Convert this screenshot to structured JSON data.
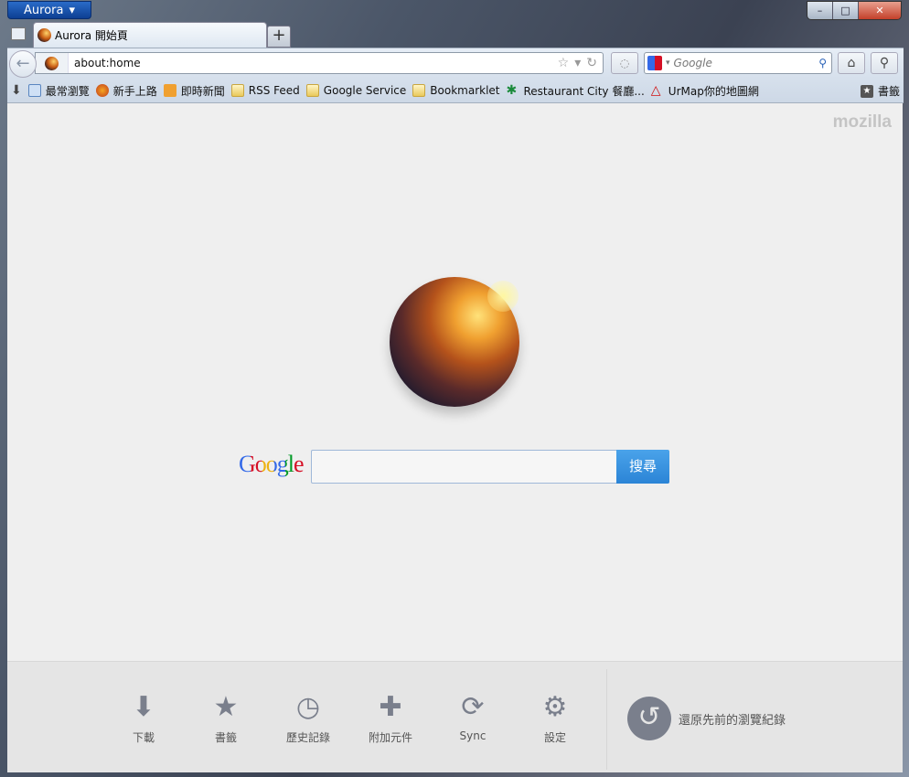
{
  "window": {
    "app_button": "Aurora",
    "minimize": "–",
    "maximize": "□",
    "close": "✕"
  },
  "tab": {
    "title": "Aurora 開始頁",
    "new_tab": "+"
  },
  "nav": {
    "url": "about:home",
    "search_placeholder": "Google"
  },
  "bookmarks": [
    {
      "label": "最常瀏覽"
    },
    {
      "label": "新手上路"
    },
    {
      "label": "即時新聞"
    },
    {
      "label": "RSS Feed"
    },
    {
      "label": "Google Service"
    },
    {
      "label": "Bookmarklet"
    },
    {
      "label": "Restaurant City 餐廳..."
    },
    {
      "label": "UrMap你的地圖網"
    }
  ],
  "bookmarks_menu": "書籤",
  "content": {
    "brand": "mozilla",
    "search_logo": "Google",
    "search_button": "搜尋",
    "search_value": ""
  },
  "launcher": {
    "items": [
      {
        "label": "下載",
        "icon": "download-icon"
      },
      {
        "label": "書籤",
        "icon": "bookmark-star-icon"
      },
      {
        "label": "歷史記錄",
        "icon": "history-clock-icon"
      },
      {
        "label": "附加元件",
        "icon": "addons-puzzle-icon"
      },
      {
        "label": "Sync",
        "icon": "sync-icon"
      },
      {
        "label": "設定",
        "icon": "settings-gear-icon"
      }
    ],
    "restore": "還原先前的瀏覽紀錄"
  }
}
